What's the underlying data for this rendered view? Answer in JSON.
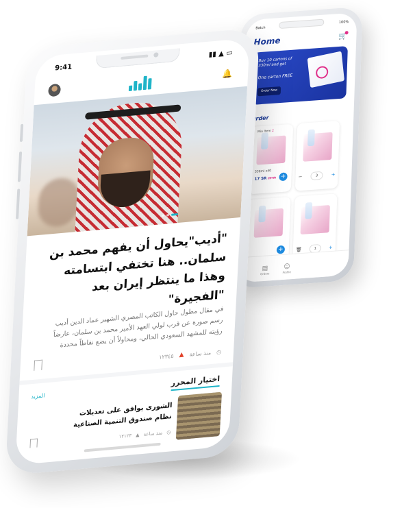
{
  "back_phone": {
    "status": {
      "carrier": "Batch",
      "battery": "100%"
    },
    "title": "Home",
    "banner": {
      "line1": "Buy 10 cartons of 330ml and get",
      "line2": "One carton FREE",
      "cta": "Order Now"
    },
    "section_title": "Order",
    "cards": [
      {
        "min_label": "Min Item",
        "min_count": "2",
        "size": "330ml x40",
        "price": "17 SR",
        "old_price": "20 SR"
      },
      {
        "stepper_value": "3"
      },
      {},
      {
        "stepper_value": "1"
      }
    ],
    "tabs": [
      {
        "label": "Orders"
      },
      {
        "label": "Profile"
      }
    ],
    "colors": {
      "brand": "#1e3c9a",
      "accent": "#e0308a",
      "action": "#1e8be0"
    }
  },
  "front_phone": {
    "status": {
      "time": "9:41"
    },
    "headline": "\"أديب\"يحاول أن يفهم محمد بن سلمان.. هنا تختفي ابتسامته وهذا ما ينتظر إيران بعد \"الفجيرة\"",
    "excerpt": "في مقال مطول حاول الكاتب المصري الشهير عماد الدين أديب رسم صورة عن قرب لولي العهد الأمير محمد بن سلمان، عارضاً رؤيته للمشهد السعودي الحالي، ومحاولاً أن يضع نقاطاً محددة",
    "meta": {
      "time_ago": "منذ ساعة",
      "views": "١٢٣٤٥"
    },
    "section_tab": "اختيار المحرر",
    "more": "المزيد",
    "related": {
      "title": "الشورى يوافق على تعديلات نظام صندوق التنمية الصناعية",
      "time_ago": "منذ ساعة",
      "views": "١٢١٢٣"
    },
    "colors": {
      "accent": "#1fb4c8",
      "hot": "#e2432a"
    }
  }
}
